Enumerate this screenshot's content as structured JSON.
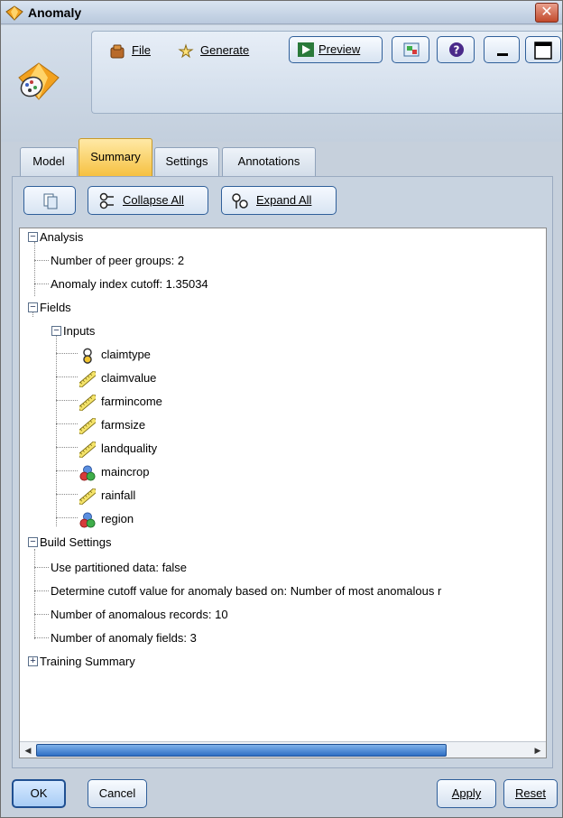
{
  "window": {
    "title": "Anomaly",
    "close_glyph": "✕"
  },
  "toolbar": {
    "file_label": "File",
    "generate_label": "Generate",
    "preview_label": "Preview",
    "icons": [
      "file-menu-icon",
      "generate-menu-icon",
      "preview-icon",
      "node-options-icon",
      "help-icon",
      "minimize-icon",
      "maximize-icon"
    ]
  },
  "tabs": [
    {
      "label": "Model",
      "active": false
    },
    {
      "label": "Summary",
      "active": true
    },
    {
      "label": "Settings",
      "active": false
    },
    {
      "label": "Annotations",
      "active": false
    }
  ],
  "summary_toolbar": {
    "collapse_all_label": "Collapse All",
    "expand_all_label": "Expand All"
  },
  "tree": {
    "analysis": {
      "label": "Analysis",
      "expanded": true,
      "items": [
        "Number of peer groups: 2",
        "Anomaly index cutoff: 1.35034"
      ]
    },
    "fields": {
      "label": "Fields",
      "expanded": true,
      "inputs": {
        "label": "Inputs",
        "expanded": true,
        "items": [
          {
            "name": "claimtype",
            "icon": "flag-field-icon"
          },
          {
            "name": "claimvalue",
            "icon": "continuous-field-icon"
          },
          {
            "name": "farmincome",
            "icon": "continuous-field-icon"
          },
          {
            "name": "farmsize",
            "icon": "continuous-field-icon"
          },
          {
            "name": "landquality",
            "icon": "continuous-field-icon"
          },
          {
            "name": "maincrop",
            "icon": "nominal-field-icon"
          },
          {
            "name": "rainfall",
            "icon": "continuous-field-icon"
          },
          {
            "name": "region",
            "icon": "nominal-field-icon"
          }
        ]
      }
    },
    "build_settings": {
      "label": "Build Settings",
      "expanded": true,
      "items": [
        "Use partitioned data: false",
        "Determine cutoff value for anomaly based on: Number of most anomalous r",
        "Number of anomalous records: 10",
        "Number of anomaly fields: 3"
      ]
    },
    "training_summary": {
      "label": "Training Summary",
      "expanded": false
    }
  },
  "buttons": {
    "ok": "OK",
    "cancel": "Cancel",
    "apply": "Apply",
    "reset": "Reset"
  },
  "expander": {
    "expanded": "−",
    "collapsed": "+"
  },
  "colors": {
    "accent": "#2f5f9a",
    "active_tab": "#f6c141",
    "scroll_thumb": "#2e6fc4"
  }
}
